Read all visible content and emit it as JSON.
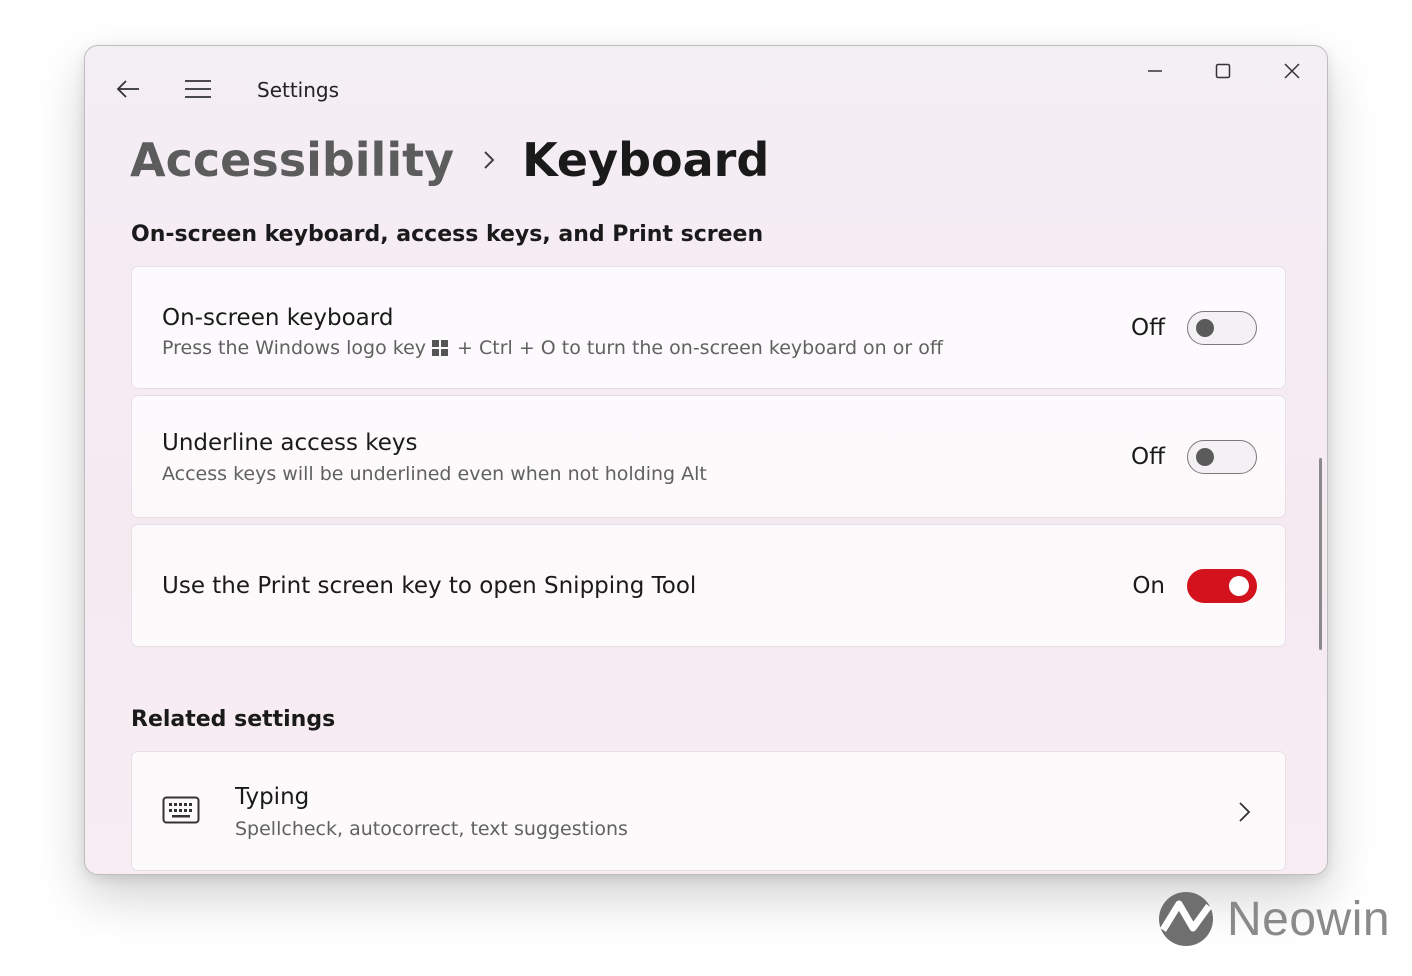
{
  "window": {
    "title": "Settings",
    "controls": {
      "back_icon": "arrow-left",
      "menu_icon": "hamburger",
      "minimize_icon": "minimize",
      "maximize_icon": "maximize",
      "close_icon": "close"
    }
  },
  "breadcrumb": {
    "parent": "Accessibility",
    "separator_icon": "chevron-right",
    "current": "Keyboard"
  },
  "section1": {
    "title": "On-screen keyboard, access keys, and Print screen",
    "items": [
      {
        "title": "On-screen keyboard",
        "desc_before_icon": "Press the Windows logo key",
        "desc_icon": "windows-logo",
        "desc_after_icon": "+ Ctrl + O to turn the on-screen keyboard on or off",
        "state_label": "Off",
        "toggle_on": false
      },
      {
        "title": "Underline access keys",
        "desc": "Access keys will be underlined even when not holding Alt",
        "state_label": "Off",
        "toggle_on": false
      },
      {
        "title": "Use the Print screen key to open Snipping Tool",
        "state_label": "On",
        "toggle_on": true
      }
    ]
  },
  "related": {
    "title": "Related settings",
    "items": [
      {
        "icon": "keyboard-icon",
        "title": "Typing",
        "desc": "Spellcheck, autocorrect, text suggestions",
        "chevron_icon": "chevron-right"
      }
    ]
  },
  "watermark": {
    "text": "Neowin"
  },
  "colors": {
    "accent": "#d3121d",
    "window_bg": "#f4eef5",
    "card_bg": "#fbf8fb"
  }
}
